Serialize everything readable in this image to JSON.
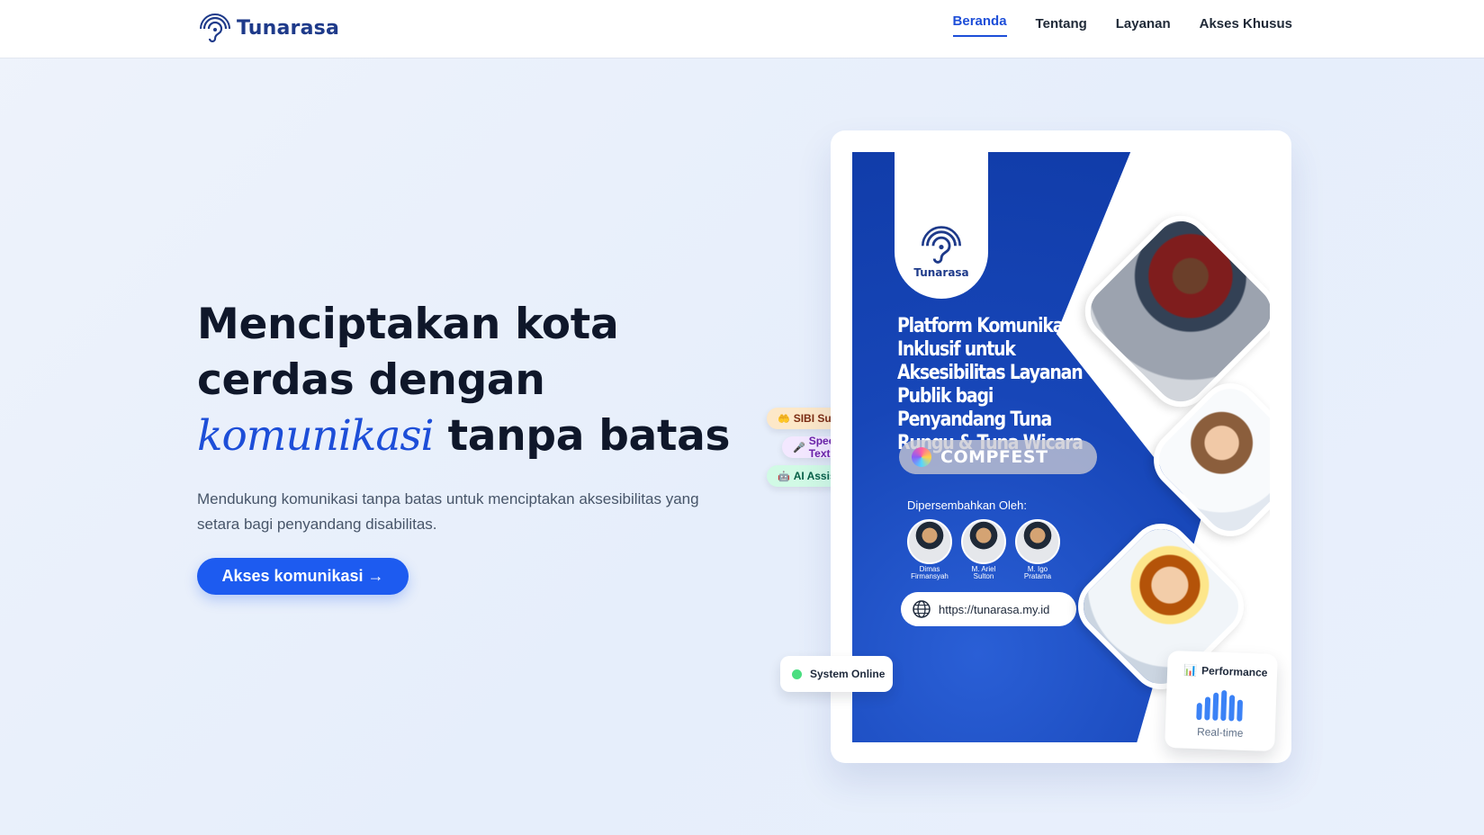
{
  "nav": {
    "brand": "Tunarasa",
    "brand_icon": "ear-wave-icon",
    "links": [
      {
        "label": "Beranda",
        "active": true
      },
      {
        "label": "Tentang",
        "active": false
      },
      {
        "label": "Layanan",
        "active": false
      },
      {
        "label": "Akses Khusus",
        "active": false
      }
    ]
  },
  "hero": {
    "title_part1": "Menciptakan kota cerdas dengan ",
    "title_accent": "komunikasi",
    "title_part2": " tanpa batas",
    "subtitle": "Mendukung komunikasi tanpa batas untuk menciptakan aksesibilitas yang setara bagi penyandang disabilitas.",
    "cta_label": "Akses komunikasi →"
  },
  "poster": {
    "logo_name": "Tunarasa",
    "headline": "Platform Komunikasi Inklusif untuk Aksesibilitas Layanan Publik bagi Penyandang Tuna Rungu & Tuna Wicara",
    "event": "COMPFEST",
    "presented_by": "Dipersembahkan Oleh:",
    "members": [
      "Dimas\nFirmansyah",
      "M. Ariel\nSulton",
      "M. Igo\nPratama"
    ],
    "url": "https://tunarasa.my.id"
  },
  "badges": {
    "sibi": {
      "icon": "🤲",
      "label": "SIBI Support"
    },
    "stt": {
      "icon": "🎤",
      "label": "Speech-to-Text"
    },
    "ai": {
      "icon": "🤖",
      "label": "AI Assistant"
    }
  },
  "status": {
    "label": "System Online",
    "color": "#4ade80"
  },
  "performance": {
    "icon": "📊",
    "title": "Performance",
    "subtitle": "Real-time",
    "bars": [
      0.55,
      0.75,
      0.9,
      1.0,
      0.85,
      0.7
    ]
  },
  "colors": {
    "accent": "#1d4ed8",
    "cta": "#1d5bf0",
    "poster_blue": "#0f3aa6"
  }
}
